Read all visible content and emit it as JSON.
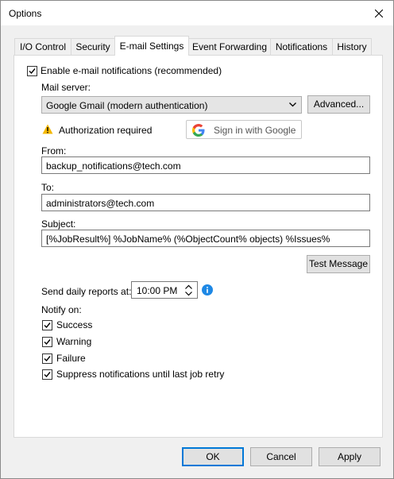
{
  "window": {
    "title": "Options",
    "close_icon": "close-icon"
  },
  "tabs": [
    {
      "label": "I/O Control",
      "active": false
    },
    {
      "label": "Security",
      "active": false
    },
    {
      "label": "E-mail Settings",
      "active": true
    },
    {
      "label": "Event Forwarding",
      "active": false
    },
    {
      "label": "Notifications",
      "active": false
    },
    {
      "label": "History",
      "active": false
    }
  ],
  "email": {
    "enable_label": "Enable e-mail notifications (recommended)",
    "enable_checked": true,
    "mail_server_label": "Mail server:",
    "mail_server_value": "Google Gmail (modern authentication)",
    "advanced_label": "Advanced...",
    "auth_status": "Authorization required",
    "sign_in_label": "Sign in with Google",
    "from_label": "From:",
    "from_value": "backup_notifications@tech.com",
    "to_label": "To:",
    "to_value": "administrators@tech.com",
    "subject_label": "Subject:",
    "subject_value": "[%JobResult%] %JobName% (%ObjectCount% objects) %Issues%",
    "test_message_label": "Test Message",
    "daily_reports_label": "Send daily reports at:",
    "daily_time": "10:00 PM",
    "notify_on_label": "Notify on:",
    "notify_options": [
      {
        "label": "Success",
        "checked": true
      },
      {
        "label": "Warning",
        "checked": true
      },
      {
        "label": "Failure",
        "checked": true
      },
      {
        "label": "Suppress notifications until last job retry",
        "checked": true
      }
    ]
  },
  "footer": {
    "ok_label": "OK",
    "cancel_label": "Cancel",
    "apply_label": "Apply"
  },
  "colors": {
    "accent": "#0078d7",
    "info": "#1e88e5",
    "warning": "#f5b800"
  }
}
